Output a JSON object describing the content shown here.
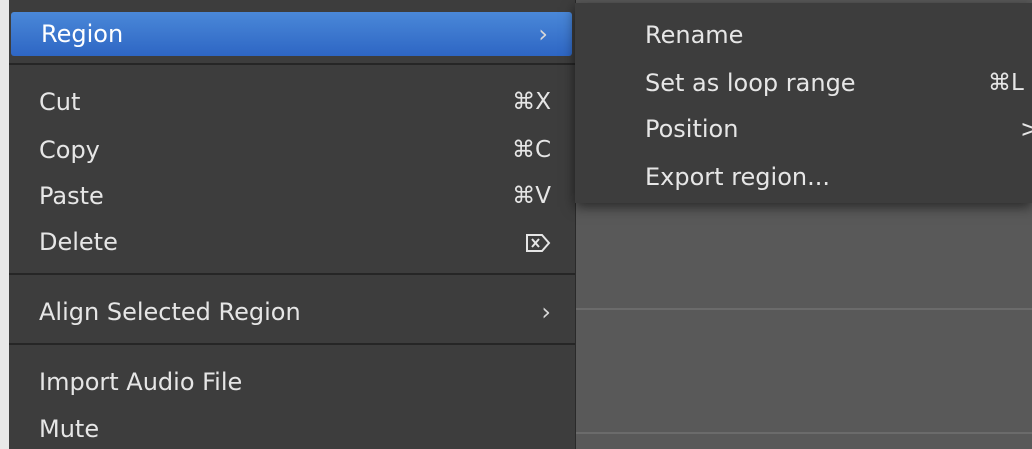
{
  "menu": {
    "items": [
      {
        "label": "Region",
        "shortcut": "",
        "submenu": true,
        "selected": true
      },
      {
        "label": "Cut",
        "shortcut": "⌘X"
      },
      {
        "label": "Copy",
        "shortcut": "⌘C"
      },
      {
        "label": "Paste",
        "shortcut": "⌘V"
      },
      {
        "label": "Delete",
        "shortcut_icon": "delete-forward-icon"
      },
      {
        "label": "Align Selected Region",
        "submenu": true
      },
      {
        "label": "Import Audio File"
      },
      {
        "label": "Mute"
      }
    ],
    "chevron": "›"
  },
  "submenu": {
    "items": [
      {
        "label": "Rename"
      },
      {
        "label": "Set as loop range",
        "shortcut": "⌘L"
      },
      {
        "label": "Position",
        "submenu": true
      },
      {
        "label": "Export region..."
      }
    ],
    "chevron": ">"
  },
  "colors": {
    "menu_bg": "#3d3d3d",
    "highlight": "#3a78d2",
    "text": "#e6e6e6"
  }
}
